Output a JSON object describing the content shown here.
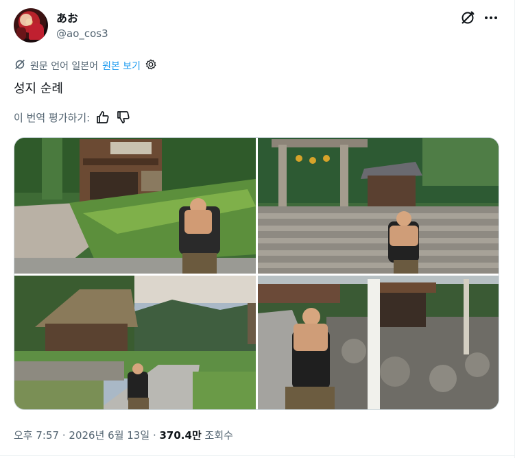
{
  "author": {
    "display_name": "あお",
    "handle": "@ao_cos3"
  },
  "translation": {
    "language_label": "원문 언어 일본어",
    "show_original": "원본 보기"
  },
  "tweet": {
    "text": "성지 순례"
  },
  "rating": {
    "prompt": "이 번역 평가하기:"
  },
  "media": {
    "photos": [
      {
        "icon": "photo-house-garden"
      },
      {
        "icon": "photo-shrine-steps"
      },
      {
        "icon": "photo-thatched-village"
      },
      {
        "icon": "photo-signpost-road"
      }
    ]
  },
  "meta": {
    "time": "오후 7:57",
    "separator1": "·",
    "date": "2026년 6월 13일",
    "separator2": "·",
    "views_count": "370.4만",
    "views_label": "조회수"
  },
  "icons": {
    "grok": "grok-icon",
    "more": "more-icon",
    "translate": "translate-icon",
    "settings": "gear-icon",
    "thumb_up": "thumbs-up-icon",
    "thumb_down": "thumbs-down-icon"
  },
  "colors": {
    "accent": "#1d9bf0",
    "secondary_text": "#536471",
    "primary_text": "#0f1419"
  }
}
